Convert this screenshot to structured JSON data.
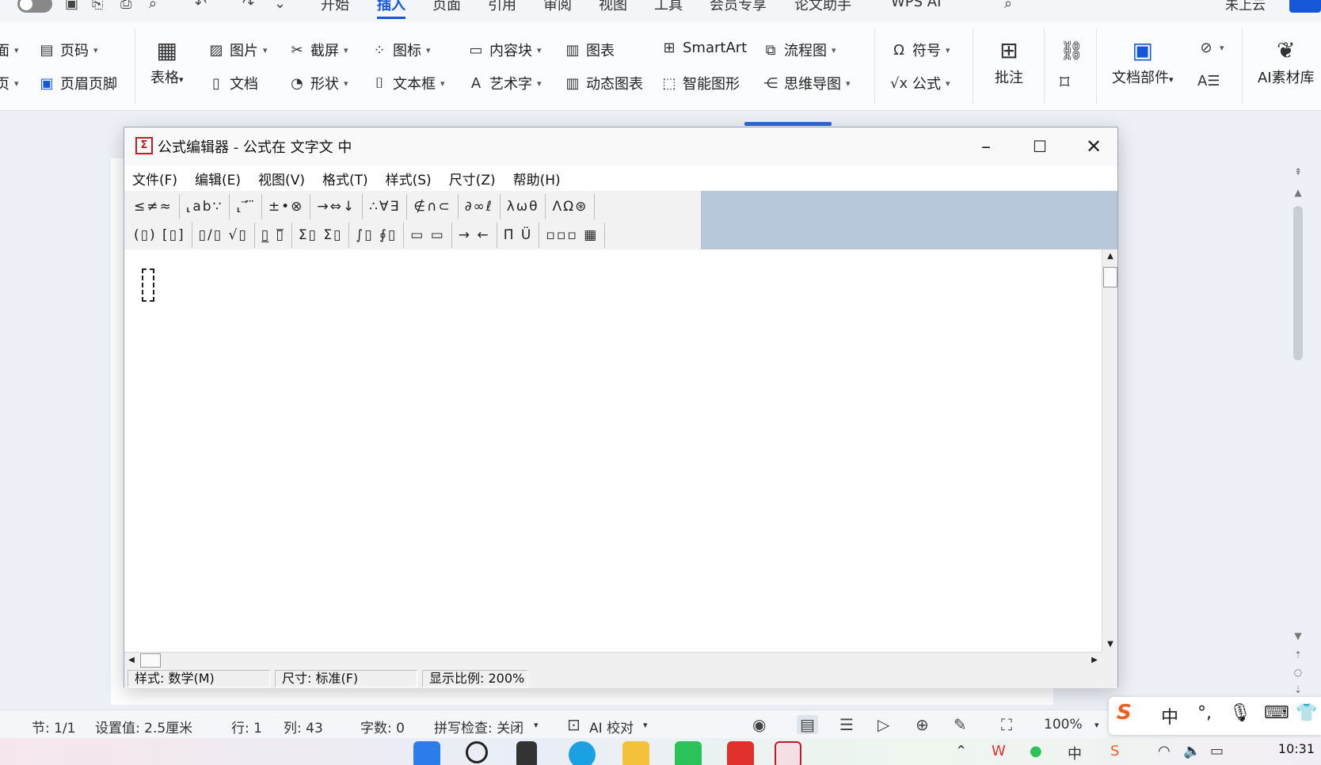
{
  "menubar": {
    "tabs": [
      "开始",
      "插入",
      "页面",
      "引用",
      "审阅",
      "视图",
      "工具",
      "会员专享",
      "论文助手",
      "WPS AI"
    ],
    "active_tab": "插入",
    "cloud": "未上云"
  },
  "ribbon": {
    "page_number": "页码",
    "header_footer": "页眉页脚",
    "table": "表格",
    "picture": "图片",
    "document": "文档",
    "screenshot": "截屏",
    "shapes": "形状",
    "icons": "图标",
    "textbox": "文本框",
    "content_block": "内容块",
    "art_text": "艺术字",
    "chart": "图表",
    "dynamic_chart": "动态图表",
    "smartart": "SmartArt",
    "smart_graphic": "智能图形",
    "flowchart": "流程图",
    "mindmap": "思维导图",
    "symbol": "符号",
    "formula": "公式",
    "comment": "批注",
    "doc_parts": "文档部件",
    "ai_material": "AI素材库"
  },
  "equation_editor": {
    "title": "公式编辑器 - 公式在 文字文 中",
    "menu": [
      "文件(F)",
      "编辑(E)",
      "视图(V)",
      "格式(T)",
      "样式(S)",
      "尺寸(Z)",
      "帮助(H)"
    ],
    "toolbar_row1": [
      "≤≠≈",
      "⸤ab∵",
      "⸤ ⃗ ⃛",
      "±•⊗",
      "→⇔↓",
      "∴∀∃",
      "∉∩⊂",
      "∂∞ℓ",
      "λωθ",
      "ΛΩ⊛"
    ],
    "toolbar_row2": [
      "(▯) [▯]",
      "▯/▯ √▯",
      "▯̲ ▯̅",
      "Σ▯ Σ▯",
      "∫▯ ∮▯",
      "▭ ▭",
      "→ ←",
      "Π̄ Ü",
      "▫▫▫ ▦"
    ],
    "status_style": "样式: 数学(M)",
    "status_size": "尺寸: 标准(F)",
    "status_zoom": "显示比例: 200%"
  },
  "statusbar": {
    "section": "节: 1/1",
    "setting": "设置值: 2.5厘米",
    "row": "行: 1",
    "col": "列: 43",
    "words": "字数: 0",
    "spellcheck": "拼写检查: 关闭",
    "ai_proof": "AI 校对",
    "zoom": "100%"
  },
  "ime": {
    "lang": "中"
  },
  "taskbar": {
    "time": "10:31"
  }
}
